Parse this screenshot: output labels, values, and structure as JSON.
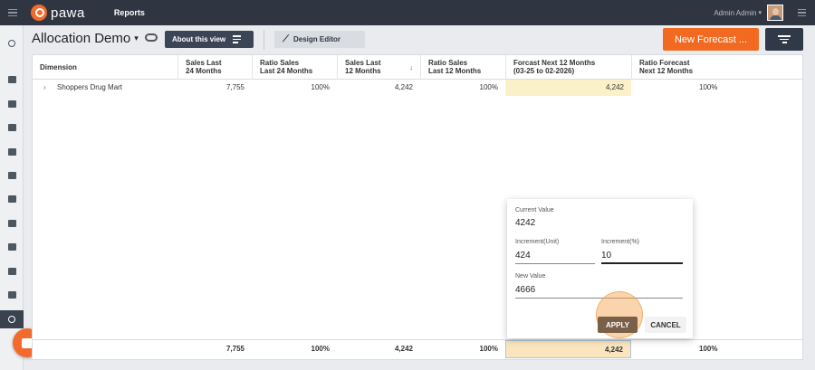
{
  "topbar": {
    "logo_text": "pawa",
    "nav_reports": "Reports",
    "user_name": "Admin Admin",
    "caret": "▾"
  },
  "header": {
    "title": "Allocation Demo",
    "title_caret": "▾",
    "about_label": "About this view",
    "design_label": "Design Editor",
    "forecast_label": "New Forecast ..."
  },
  "table": {
    "columns": [
      {
        "line1": "Dimension",
        "line2": ""
      },
      {
        "line1": "Sales Last",
        "line2": "24 Months"
      },
      {
        "line1": "Ratio Sales",
        "line2": "Last 24 Months"
      },
      {
        "line1": "Sales Last",
        "line2": "12 Months"
      },
      {
        "line1": "Ratio Sales",
        "line2": "Last 12 Months"
      },
      {
        "line1": "Forcast Next 12 Months",
        "line2": "(03-25 to 02-2026)"
      },
      {
        "line1": "Ratio Forecast",
        "line2": "Next 12 Months"
      }
    ],
    "sort_indicator": "↓",
    "rows": [
      {
        "expander": "›",
        "dimension": "Shoppers Drug Mart",
        "sales24": "7,755",
        "ratio24": "100%",
        "sales12": "4,242",
        "ratio12": "100%",
        "forecast": "4,242",
        "ratio_forecast": "100%"
      }
    ],
    "totals": {
      "sales24": "7,755",
      "ratio24": "100%",
      "sales12": "4,242",
      "ratio12": "100%",
      "forecast": "4,242",
      "ratio_forecast": "100%"
    }
  },
  "popover": {
    "current_value_label": "Current Value",
    "current_value": "4242",
    "increment_unit_label": "Increment(Unit)",
    "increment_unit_value": "424",
    "increment_pct_label": "Increment(%)",
    "increment_pct_value": "10",
    "new_value_label": "New Value",
    "new_value": "4666",
    "apply_label": "APPLY",
    "cancel_label": "CANCEL"
  },
  "colors": {
    "accent": "#f26a21",
    "topbar": "#303641",
    "highlight": "#fbf1c8"
  }
}
